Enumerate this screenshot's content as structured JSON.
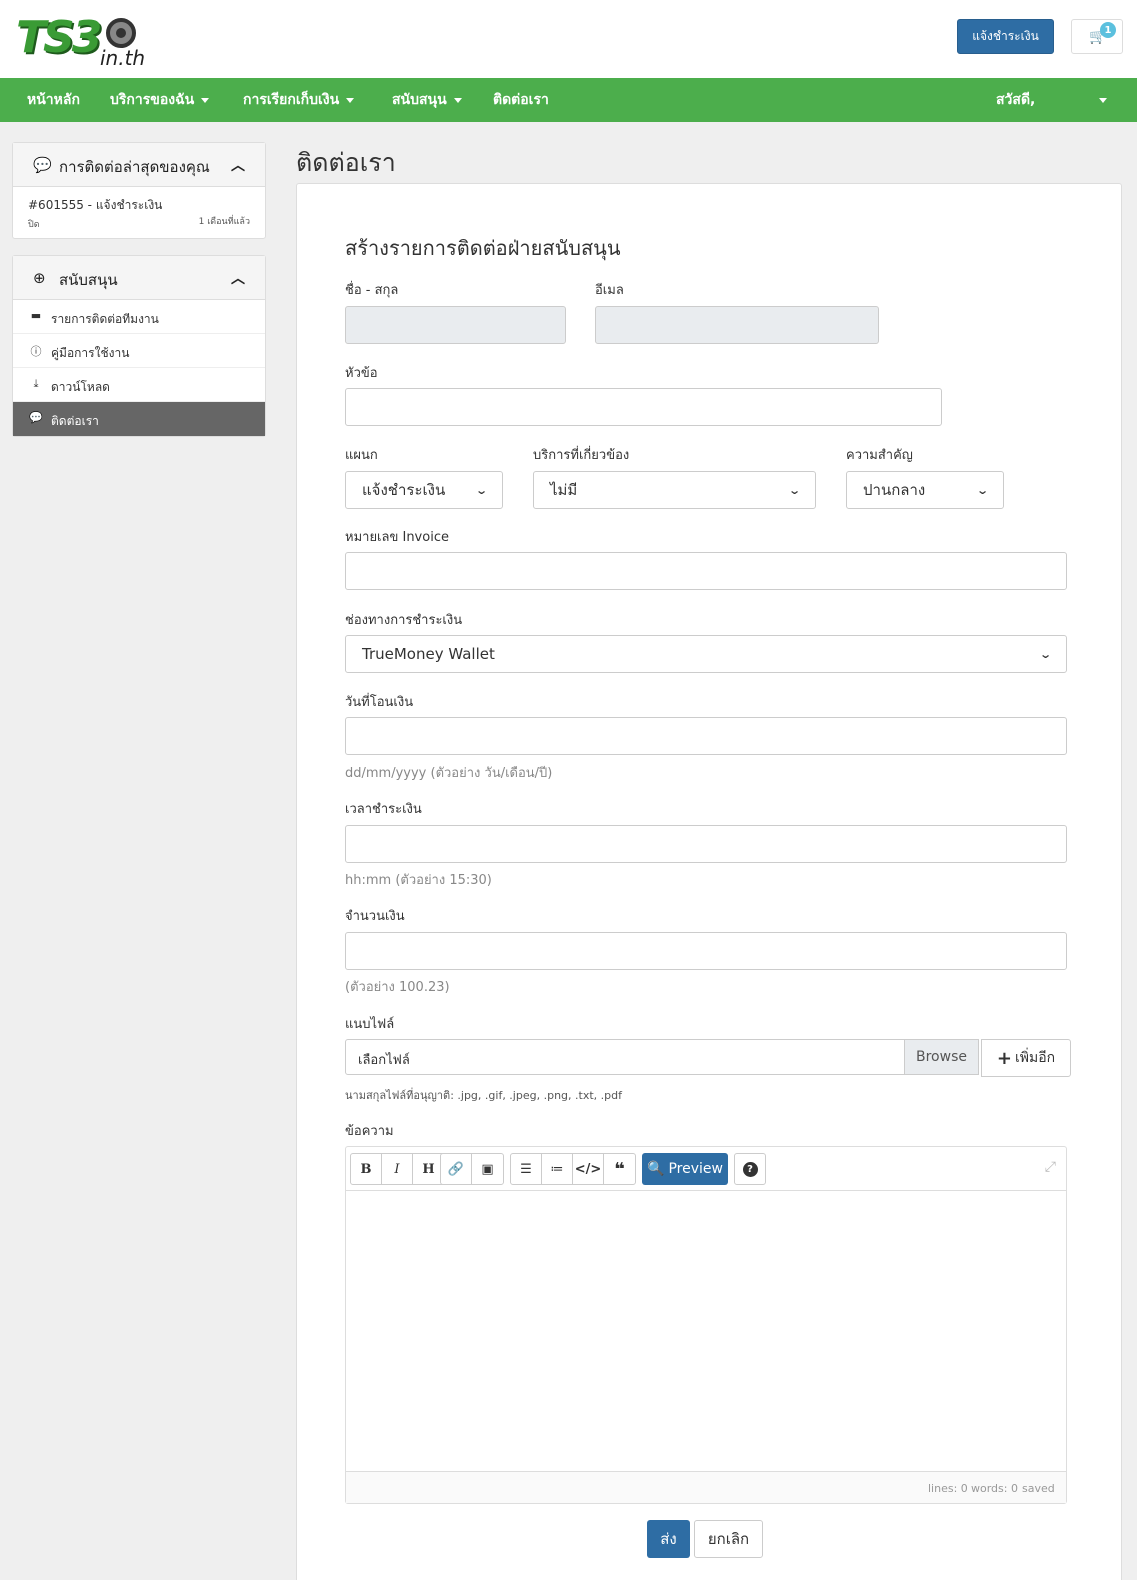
{
  "header": {
    "logo_text": "TS3",
    "logo_sub": "in.th",
    "notify_button": "แจ้งชำระเงิน",
    "cart_count": "1"
  },
  "nav": {
    "items": [
      {
        "label": "หน้าหลัก"
      },
      {
        "label": "บริการของฉัน"
      },
      {
        "label": "การเรียกเก็บเงิน"
      },
      {
        "label": "สนับสนุน"
      },
      {
        "label": "ติดต่อเรา"
      }
    ],
    "greeting": "สวัสดี,"
  },
  "sidebar": {
    "recent": {
      "title": "การติดต่อล่าสุดของคุณ",
      "ticket_title": "#601555 - แจ้งชำระเงิน",
      "ticket_status": "ปิด",
      "ticket_time": "1 เดือนที่แล้ว"
    },
    "support": {
      "title": "สนับสนุน",
      "items": [
        {
          "label": "รายการติดต่อทีมงาน"
        },
        {
          "label": "คู่มือการใช้งาน"
        },
        {
          "label": "ดาวน์โหลด"
        },
        {
          "label": "ติดต่อเรา"
        }
      ]
    }
  },
  "main": {
    "page_title": "ติดต่อเรา",
    "form_title": "สร้างรายการติดต่อฝ่ายสนับสนุน",
    "name_label": "ชื่อ - สกุล",
    "email_label": "อีเมล",
    "subject_label": "หัวข้อ",
    "department_label": "แผนก",
    "department_value": "แจ้งชำระเงิน",
    "service_label": "บริการที่เกี่ยวข้อง",
    "service_value": "ไม่มี",
    "priority_label": "ความสำคัญ",
    "priority_value": "ปานกลาง",
    "invoice_label": "หมายเลข Invoice",
    "payment_label": "ช่องทางการชำระเงิน",
    "payment_value": "TrueMoney Wallet",
    "transfer_date_label": "วันที่โอนเงิน",
    "transfer_date_help": "dd/mm/yyyy (ตัวอย่าง วัน/เดือน/ปี)",
    "pay_time_label": "เวลาชำระเงิน",
    "pay_time_help": "hh:mm (ตัวอย่าง 15:30)",
    "amount_label": "จำนวนเงิน",
    "amount_help": "(ตัวอย่าง 100.23)",
    "attach_label": "แนบไฟล์",
    "file_placeholder": "เลือกไฟล์",
    "browse_label": "Browse",
    "add_more_label": "เพิ่มอีก",
    "allowed_ext": "นามสกุลไฟล์ที่อนุญาติ: .jpg, .gif, .jpeg, .png, .txt, .pdf",
    "message_label": "ข้อความ",
    "preview_label": "Preview",
    "status_lines": "lines: 0",
    "status_words": "words: 0",
    "status_saved": "saved",
    "submit_label": "ส่ง",
    "cancel_label": "ยกเลิก"
  },
  "colors": {
    "nav_green": "#4cae4c",
    "primary_blue": "#2e6da4",
    "badge_cyan": "#5bc0de"
  }
}
